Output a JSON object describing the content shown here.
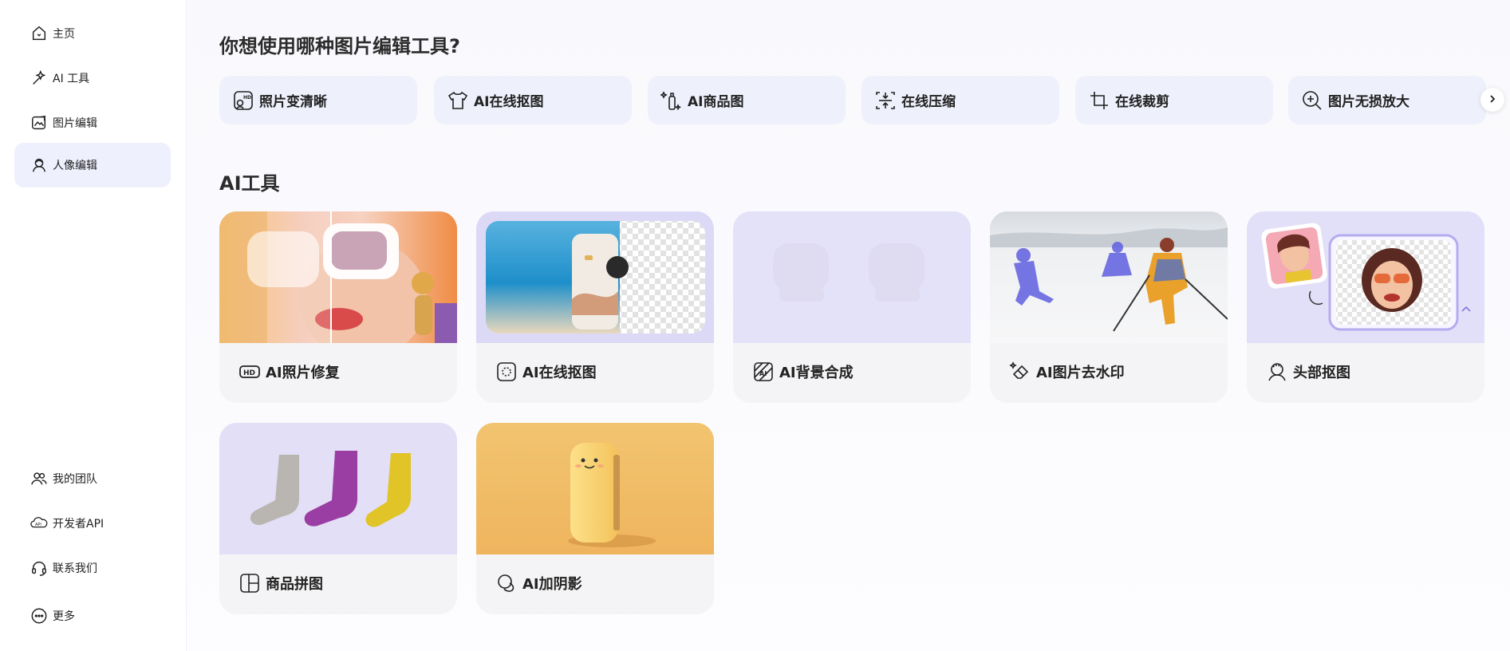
{
  "sidebar": {
    "top_items": [
      {
        "label": "主页",
        "icon": "home-icon"
      },
      {
        "label": "AI 工具",
        "icon": "magic-wand-icon"
      },
      {
        "label": "图片编辑",
        "icon": "image-edit-icon"
      },
      {
        "label": "人像编辑",
        "icon": "portrait-icon",
        "active": true
      }
    ],
    "bottom_items": [
      {
        "label": "我的团队",
        "icon": "team-icon"
      },
      {
        "label": "开发者API",
        "icon": "api-icon"
      },
      {
        "label": "联系我们",
        "icon": "headset-icon"
      },
      {
        "label": "更多",
        "icon": "more-icon"
      }
    ]
  },
  "main": {
    "question_heading": "你想使用哪种图片编辑工具?",
    "quick_tools": [
      {
        "label": "照片变清晰",
        "icon": "hd-photo-icon"
      },
      {
        "label": "AI在线抠图",
        "icon": "tshirt-icon"
      },
      {
        "label": "AI商品图",
        "icon": "bottle-sparkle-icon"
      },
      {
        "label": "在线压缩",
        "icon": "compress-icon"
      },
      {
        "label": "在线裁剪",
        "icon": "crop-icon"
      },
      {
        "label": "图片无损放大",
        "icon": "zoom-in-icon"
      }
    ],
    "section_title": "AI工具",
    "cards": [
      {
        "label": "AI照片修复",
        "icon": "hd-badge-icon"
      },
      {
        "label": "AI在线抠图",
        "icon": "cutout-icon"
      },
      {
        "label": "AI背景合成",
        "icon": "ai-background-icon"
      },
      {
        "label": "AI图片去水印",
        "icon": "eraser-sparkle-icon"
      },
      {
        "label": "头部抠图",
        "icon": "head-cutout-icon"
      },
      {
        "label": "商品拼图",
        "icon": "collage-icon"
      },
      {
        "label": "AI加阴影",
        "icon": "shadow-icon"
      }
    ]
  },
  "colors": {
    "accent_bg": "#eef0fd",
    "card_bg": "#f4f4f6",
    "lavender": "#e4e2f8"
  }
}
